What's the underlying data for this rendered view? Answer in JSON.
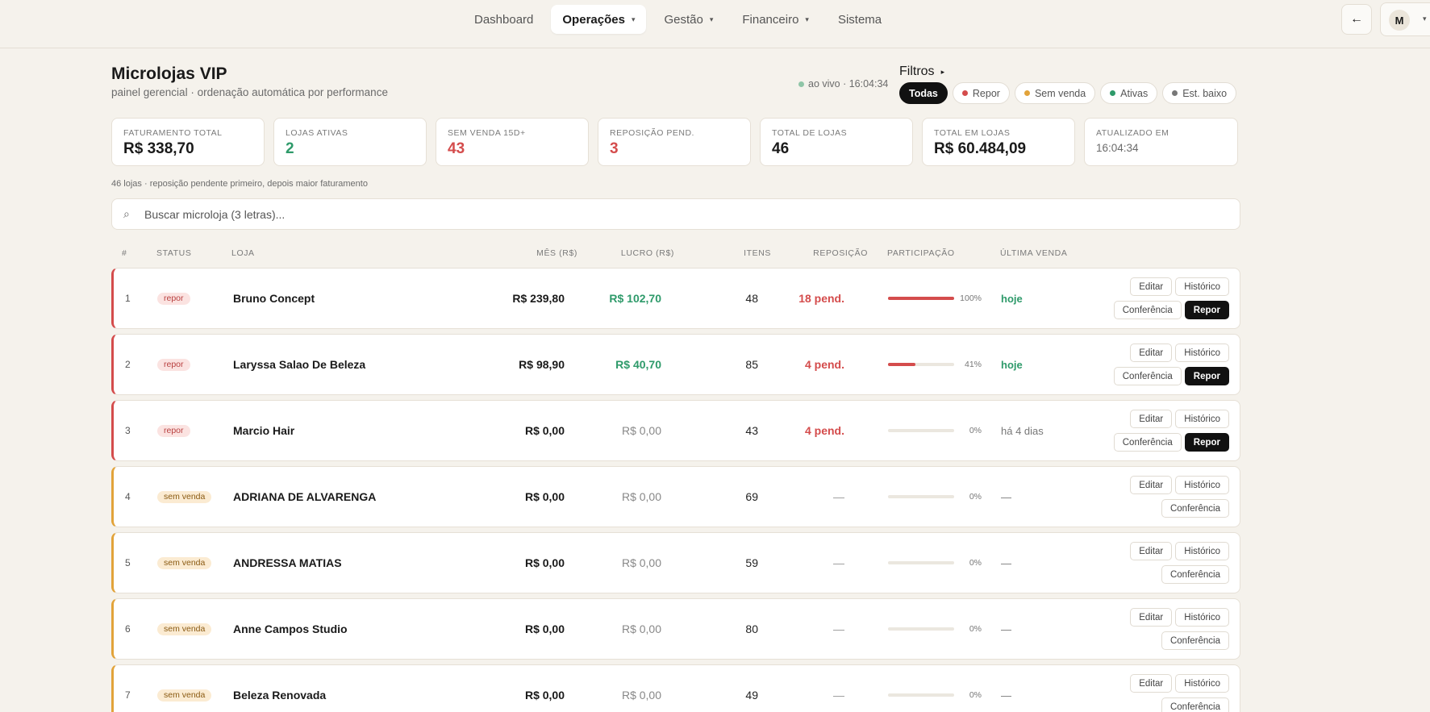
{
  "nav": {
    "items": [
      {
        "label": "Dashboard",
        "active": false,
        "has_caret": false
      },
      {
        "label": "Operações",
        "active": true,
        "has_caret": true
      },
      {
        "label": "Gestão",
        "active": false,
        "has_caret": true
      },
      {
        "label": "Financeiro",
        "active": false,
        "has_caret": true
      },
      {
        "label": "Sistema",
        "active": false,
        "has_caret": false
      }
    ],
    "caret": "▾",
    "back_icon": "←",
    "avatar_initial": "M"
  },
  "header": {
    "title": "Microlojas VIP",
    "subtitle": "painel gerencial · ordenação automática por performance",
    "live_text": "ao vivo · 16:04:34"
  },
  "filters": {
    "title": "Filtros",
    "caret": "▸",
    "chips": [
      {
        "label": "Todas",
        "active": true,
        "dot": null
      },
      {
        "label": "Repor",
        "active": false,
        "dot": "#d44c4c"
      },
      {
        "label": "Sem venda",
        "active": false,
        "dot": "#e2a33a"
      },
      {
        "label": "Ativas",
        "active": false,
        "dot": "#2e9a6a"
      },
      {
        "label": "Est. baixo",
        "active": false,
        "dot": "#777777"
      }
    ]
  },
  "stats": [
    {
      "label": "FATURAMENTO TOTAL",
      "value": "R$ 338,70",
      "tone": "",
      "width": 190
    },
    {
      "label": "LOJAS ATIVAS",
      "value": "2",
      "tone": "green",
      "width": 190
    },
    {
      "label": "SEM VENDA 15D+",
      "value": "43",
      "tone": "red",
      "width": 190
    },
    {
      "label": "REPOSIÇÃO PEND.",
      "value": "3",
      "tone": "red",
      "width": 190
    },
    {
      "label": "TOTAL DE LOJAS",
      "value": "46",
      "tone": "",
      "width": 190
    },
    {
      "label": "TOTAL EM LOJAS",
      "value": "R$ 60.484,09",
      "tone": "",
      "width": 190
    },
    {
      "label": "ATUALIZADO EM",
      "value": "16:04:34",
      "tone": "small",
      "width": 191
    }
  ],
  "sort_note": "46 lojas · reposição pendente primeiro, depois maior faturamento",
  "search": {
    "placeholder": "Buscar microloja (3 letras)...",
    "icon": "⌕"
  },
  "table": {
    "headers": {
      "num": "#",
      "status": "STATUS",
      "loja": "LOJA",
      "mes": "MÊS (R$)",
      "lucro": "LUCRO (R$)",
      "itens": "ITENS",
      "repos": "REPOSIÇÃO",
      "part": "PARTICIPAÇÃO",
      "ultima": "ÚLTIMA VENDA"
    },
    "actions": {
      "editar": "Editar",
      "historico": "Histórico",
      "conferencia": "Conferência",
      "repor": "Repor"
    },
    "rows": [
      {
        "num": "1",
        "status": "repor",
        "name": "Bruno Concept",
        "mes": "R$ 239,80",
        "lucro": "R$ 102,70",
        "itens": "48",
        "repos": "18 pend.",
        "part": 1.0,
        "part_label": "100%",
        "ultima": "hoje"
      },
      {
        "num": "2",
        "status": "repor",
        "name": "Laryssa Salao De Beleza",
        "mes": "R$ 98,90",
        "lucro": "R$ 40,70",
        "itens": "85",
        "repos": "4 pend.",
        "part": 0.41,
        "part_label": "41%",
        "ultima": "hoje"
      },
      {
        "num": "3",
        "status": "repor",
        "name": "Marcio Hair",
        "mes": "R$ 0,00",
        "lucro": "R$ 0,00",
        "itens": "43",
        "repos": "4 pend.",
        "part": 0,
        "part_label": "0%",
        "ultima": "há 4 dias"
      },
      {
        "num": "4",
        "status": "sem venda",
        "name": "ADRIANA DE ALVARENGA",
        "mes": "R$ 0,00",
        "lucro": "R$ 0,00",
        "itens": "69",
        "repos": "—",
        "part": 0,
        "part_label": "0%",
        "ultima": "—"
      },
      {
        "num": "5",
        "status": "sem venda",
        "name": "ANDRESSA MATIAS",
        "mes": "R$ 0,00",
        "lucro": "R$ 0,00",
        "itens": "59",
        "repos": "—",
        "part": 0,
        "part_label": "0%",
        "ultima": "—"
      },
      {
        "num": "6",
        "status": "sem venda",
        "name": "Anne Campos Studio",
        "mes": "R$ 0,00",
        "lucro": "R$ 0,00",
        "itens": "80",
        "repos": "—",
        "part": 0,
        "part_label": "0%",
        "ultima": "—"
      },
      {
        "num": "7",
        "status": "sem venda",
        "name": "Beleza Renovada",
        "mes": "R$ 0,00",
        "lucro": "R$ 0,00",
        "itens": "49",
        "repos": "—",
        "part": 0,
        "part_label": "0%",
        "ultima": "—"
      }
    ]
  }
}
